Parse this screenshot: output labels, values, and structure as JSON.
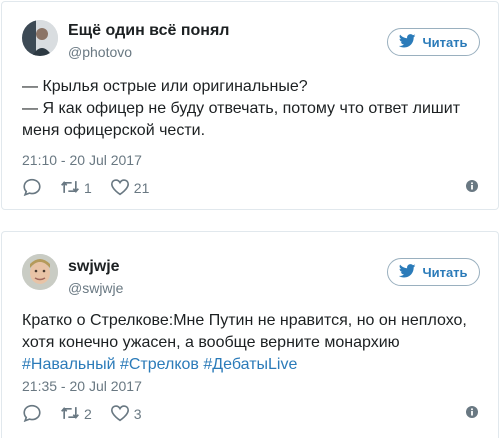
{
  "colors": {
    "link": "#2b7bb9",
    "muted": "#697882",
    "text": "#1c2022",
    "border": "#e1e8ed"
  },
  "tweets": [
    {
      "display_name": "Ещё один всё понял",
      "handle": "@photovo",
      "follow_label": "Читать",
      "lines": [
        "— Крылья острые или оригинальные?",
        "— Я как офицер не буду отвечать, потому что ответ лишит",
        "меня офицерской чести."
      ],
      "timestamp": "21:10 - 20 Jul 2017",
      "retweets": "1",
      "likes": "21",
      "replies": ""
    },
    {
      "display_name": "swjwje",
      "handle": "@swjwje",
      "follow_label": "Читать",
      "lines": [
        "Кратко о Стрелкове:Мне Путин не нравится, но он неплохо,",
        "хотя конечно ужасен, а вообще верните монархию"
      ],
      "hashtags": [
        "#Навальный",
        "#Стрелков",
        "#ДебатыLive"
      ],
      "timestamp": "21:35 - 20 Jul 2017",
      "retweets": "2",
      "likes": "3",
      "replies": ""
    }
  ]
}
